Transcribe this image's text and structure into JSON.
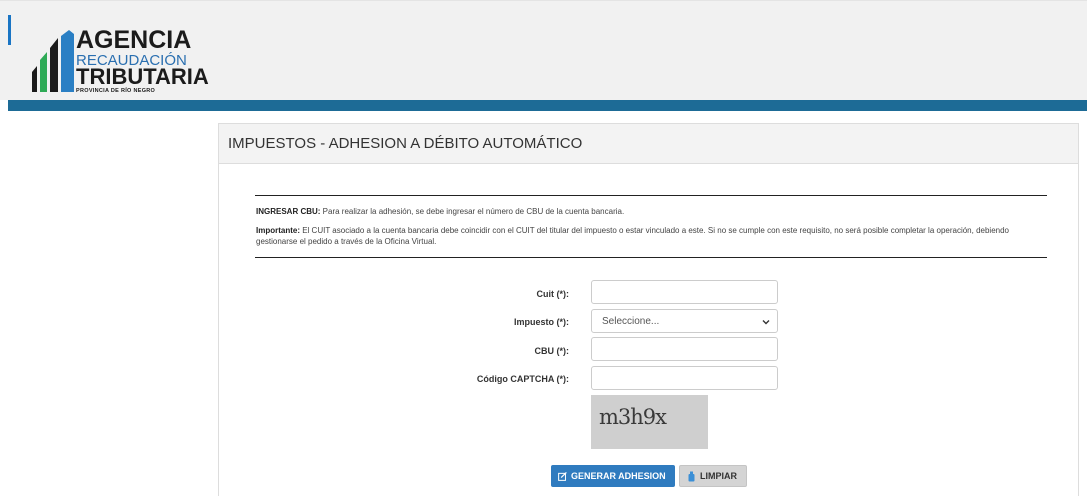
{
  "logo": {
    "line1": "AGENCIA",
    "line2": "RECAUDACIÓN",
    "line3": "TRIBUTARIA",
    "line4": "PROVINCIA DE RÍO NEGRO"
  },
  "colors": {
    "band": "#1d6b96",
    "primary": "#2f7bbf",
    "header_bg": "#f1f1f1"
  },
  "panel": {
    "title": "IMPUESTOS - ADHESION A DÉBITO AUTOMÁTICO"
  },
  "info": {
    "cbu_label": "INGRESAR CBU:",
    "cbu_text": " Para realizar la adhesión, se debe ingresar el número de CBU de la cuenta bancaria.",
    "important_label": "Importante:",
    "important_text": " El CUIT asociado a la cuenta bancaria debe coincidir con el CUIT del titular del impuesto o estar vinculado a este. Si no se cumple con este requisito, no será posible completar la operación, debiendo gestionarse el pedido a través de la Oficina Virtual."
  },
  "form": {
    "cuit_label": "Cuit (*):",
    "cuit_value": "",
    "impuesto_label": "Impuesto (*):",
    "impuesto_selected": "Seleccione...",
    "cbu_label": "CBU (*):",
    "cbu_value": "",
    "captcha_label": "Código CAPTCHA (*):",
    "captcha_value": "",
    "captcha_image_text": "m3h9x"
  },
  "buttons": {
    "generar": "GENERAR ADHESION",
    "limpiar": "LIMPIAR"
  }
}
